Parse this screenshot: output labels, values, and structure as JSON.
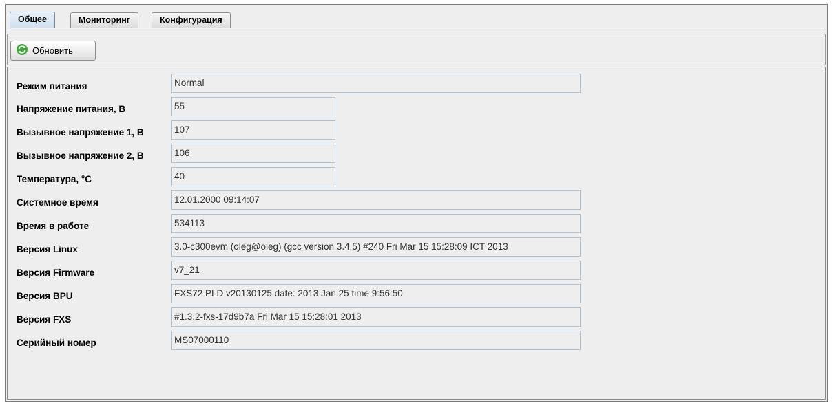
{
  "tabs": [
    {
      "label": "Общее"
    },
    {
      "label": "Мониторинг"
    },
    {
      "label": "Конфигурация"
    }
  ],
  "toolbar": {
    "refresh_label": "Обновить",
    "refresh_icon": "refresh-icon"
  },
  "fields": [
    {
      "label": "Режим питания",
      "value": "Normal"
    },
    {
      "label": "Напряжение питания, В",
      "value": "55"
    },
    {
      "label": "Вызывное напряжение 1, В",
      "value": "107"
    },
    {
      "label": "Вызывное напряжение 2, В",
      "value": "106"
    },
    {
      "label": "Температура, °С",
      "value": "40"
    },
    {
      "label": "Системное время",
      "value": "12.01.2000 09:14:07"
    },
    {
      "label": "Время в работе",
      "value": "534113"
    },
    {
      "label": "Версия Linux",
      "value": "3.0-c300evm (oleg@oleg) (gcc version 3.4.5) #240 Fri Mar 15 15:28:09 ICT 2013"
    },
    {
      "label": "Версия Firmware",
      "value": "v7_21"
    },
    {
      "label": "Версия BPU",
      "value": "FXS72 PLD v20130125 date: 2013 Jan 25 time 9:56:50"
    },
    {
      "label": "Версия FXS",
      "value": "#1.3.2-fxs-17d9b7a Fri Mar 15 15:28:01 2013"
    },
    {
      "label": "Серийный номер",
      "value": "MS07000110"
    }
  ]
}
